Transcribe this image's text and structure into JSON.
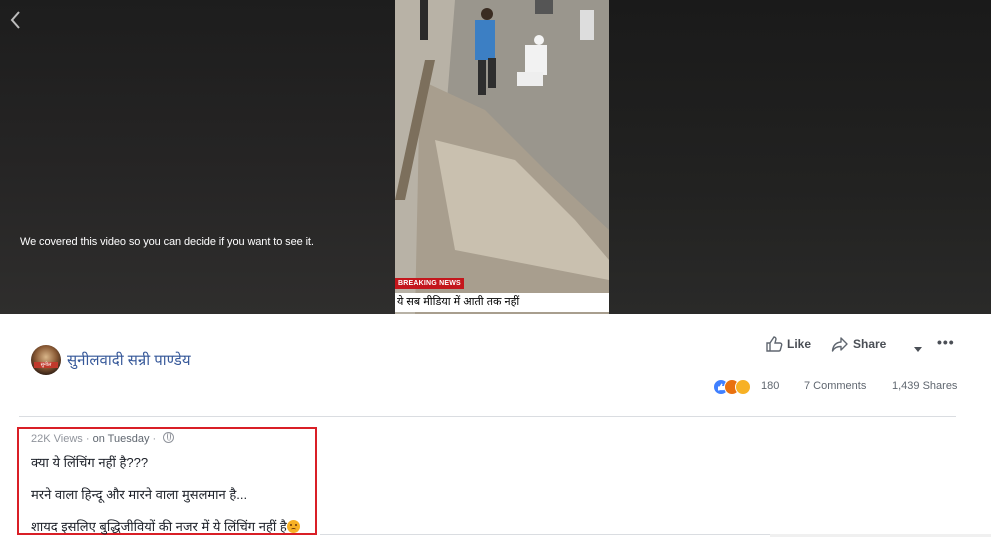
{
  "video": {
    "cover_notice": "We covered this video so you can decide if you want to see it.",
    "news_badge": "BREAKING NEWS",
    "news_caption": "ये सब मीडिया में आती तक नहीं"
  },
  "page": {
    "name": "सुनीलवादी सन्री पाण्डेय",
    "avatar_text": "सुनील"
  },
  "actions": {
    "like_label": "Like",
    "share_label": "Share"
  },
  "stats": {
    "reaction_count": "180",
    "comments": "7 Comments",
    "shares": "1,439 Shares"
  },
  "post": {
    "views": "22K Views",
    "separator": "·",
    "time": "on Tuesday",
    "lines": [
      "क्या ये लिंचिंग नहीं है???",
      "मरने वाला हिन्दू और मारने वाला मुसलमान है...",
      "शायद इसलिए बुद्धिजीवियों की नजर में ये लिंचिंग नहीं है"
    ]
  },
  "colors": {
    "link_blue": "#365899",
    "highlight_red": "#d91f26",
    "like_blue": "#4080ff"
  }
}
